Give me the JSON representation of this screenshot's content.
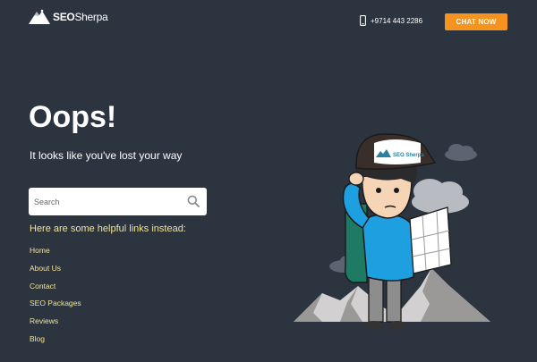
{
  "header": {
    "logo_bold": "SEO",
    "logo_light": "Sherpa",
    "phone": "+9714 443 2286",
    "chat_button": "CHAT NOW"
  },
  "main": {
    "title": "Oops!",
    "subtitle": "It looks like you've lost your way",
    "search_placeholder": "Search",
    "links_heading": "Here are some helpful links instead:",
    "links": [
      {
        "label": "Home"
      },
      {
        "label": "About Us"
      },
      {
        "label": "Contact"
      },
      {
        "label": "SEO Packages"
      },
      {
        "label": "Reviews"
      },
      {
        "label": "Blog"
      }
    ]
  },
  "illustration": {
    "cap_logo": "SEO Sherpa"
  },
  "colors": {
    "background": "#2c3440",
    "accent": "#f6921e",
    "link": "#f0e49a"
  }
}
